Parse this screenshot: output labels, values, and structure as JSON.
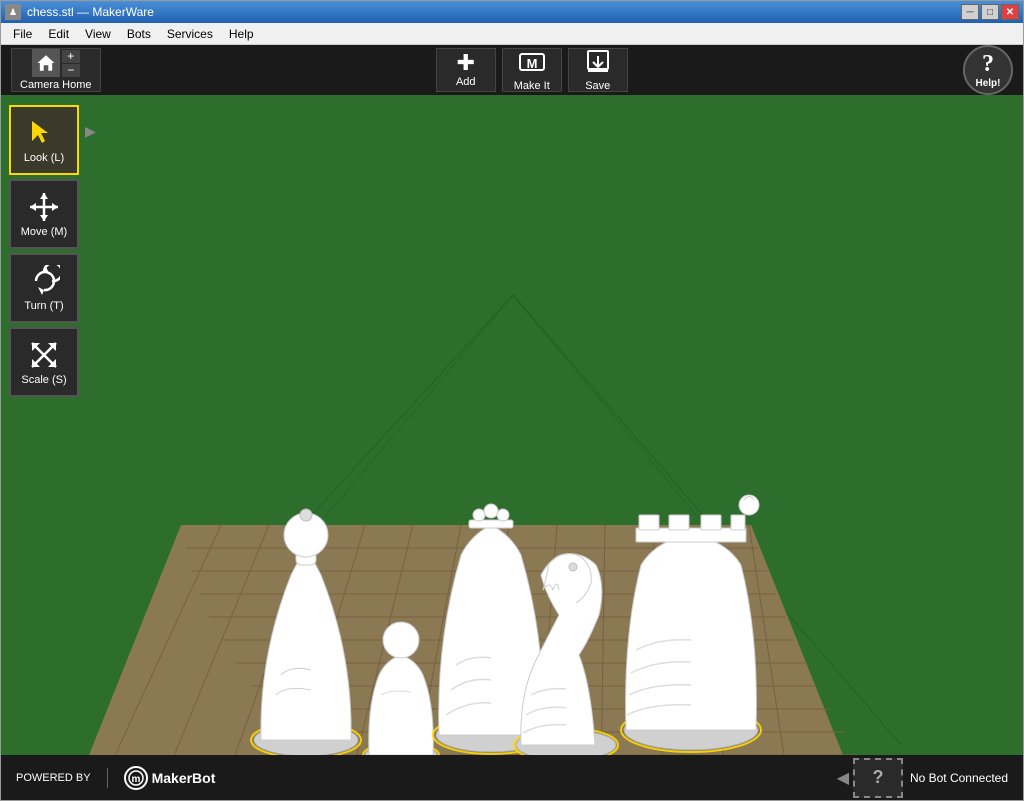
{
  "window": {
    "title": "chess.stl — MakerWare",
    "icon": "♟"
  },
  "titlebar": {
    "minimize_label": "─",
    "restore_label": "□",
    "close_label": "✕"
  },
  "menubar": {
    "items": [
      {
        "id": "file",
        "label": "File"
      },
      {
        "id": "edit",
        "label": "Edit"
      },
      {
        "id": "view",
        "label": "View"
      },
      {
        "id": "bots",
        "label": "Bots"
      },
      {
        "id": "services",
        "label": "Services"
      },
      {
        "id": "help",
        "label": "Help"
      }
    ]
  },
  "toolbar": {
    "camera_home_label": "Camera Home",
    "add_label": "Add",
    "make_it_label": "Make It",
    "save_label": "Save",
    "help_label": "Help!"
  },
  "left_tools": [
    {
      "id": "look",
      "label": "Look (L)",
      "icon": "cursor",
      "active": true
    },
    {
      "id": "move",
      "label": "Move (M)",
      "icon": "move",
      "active": false
    },
    {
      "id": "turn",
      "label": "Turn (T)",
      "icon": "turn",
      "active": false
    },
    {
      "id": "scale",
      "label": "Scale (S)",
      "icon": "scale",
      "active": false
    }
  ],
  "bottom": {
    "powered_by": "POWERED BY",
    "makerbot_label": "MakerBot",
    "no_bot_label": "No Bot Connected",
    "bot_question": "?"
  },
  "viewport": {
    "background_color": "#2d6e2d"
  }
}
